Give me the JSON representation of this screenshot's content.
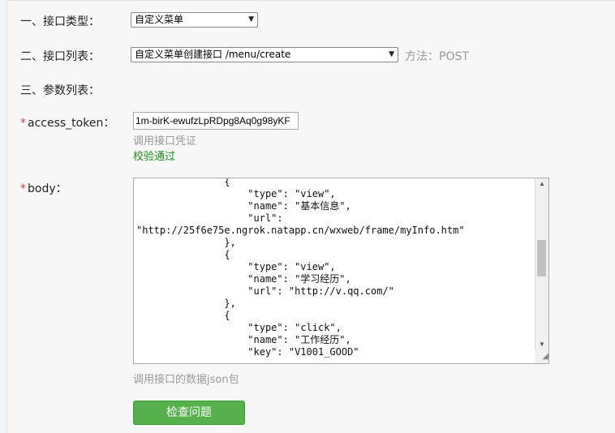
{
  "form": {
    "api_type": {
      "label": "一、接口类型：",
      "selected": "自定义菜单"
    },
    "api_list": {
      "label": "二、接口列表：",
      "selected": "自定义菜单创建接口 /menu/create",
      "method_text": "方法：POST"
    },
    "params_label": "三、参数列表：",
    "access_token": {
      "required_mark": "*",
      "label": "access_token：",
      "value": "1m-birK-ewufzLpRDpg8Aq0g98yKF",
      "hint": "调用接口凭证",
      "status": "校验通过"
    },
    "body": {
      "required_mark": "*",
      "label": "body：",
      "lines": [
        "               {",
        "                   \"type\": \"view\",",
        "                   \"name\": \"基本信息\",",
        "                   \"url\":",
        "\"http://25f6e75e.ngrok.natapp.cn/wxweb/frame/myInfo.htm\"",
        "               },",
        "               {",
        "                   \"type\": \"view\",",
        "                   \"name\": \"学习经历\",",
        "                   \"url\": \"http://v.qq.com/\"",
        "               },",
        "               {",
        "                   \"type\": \"click\",",
        "                   \"name\": \"工作经历\",",
        "                   \"key\": \"V1001_GOOD\""
      ],
      "hint": "调用接口的数据json包"
    },
    "check_button": "检查问题"
  },
  "icons": [
    "dropdown-arrow-icon",
    "scroll-up-icon",
    "scroll-down-icon",
    "resize-grip-icon"
  ]
}
